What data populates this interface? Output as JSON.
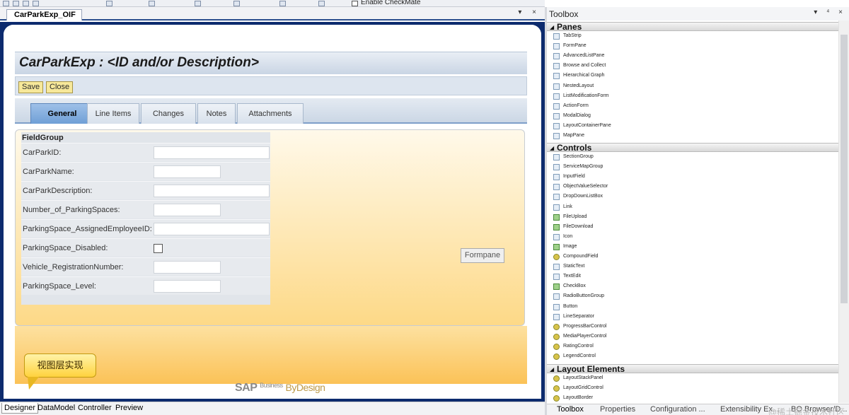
{
  "toolbar": {
    "enable_label": "Enable CheckMate"
  },
  "doc_tab": {
    "title": "CarParkExp_OIF",
    "controls": "▾ ×"
  },
  "page": {
    "title": "CarParkExp : <ID and/or Description>",
    "buttons": {
      "save": "Save",
      "close": "Close"
    },
    "tabs": [
      "General",
      "Line Items",
      "Changes",
      "Notes",
      "Attachments"
    ],
    "fieldgroup": {
      "title": "FieldGroup",
      "fields": [
        "CarParkID:",
        "CarParkName:",
        "CarParkDescription:",
        "Number_of_ParkingSpaces:",
        "ParkingSpace_AssignedEmployeeID:",
        "ParkingSpace_Disabled:",
        "Vehicle_RegistrationNumber:",
        "ParkingSpace_Level:"
      ]
    },
    "formpane_label": "Formpane",
    "callout": "视图层实现",
    "logo": {
      "sap": "SAP",
      "business": "Business",
      "bydesign": "ByDesign"
    }
  },
  "bottom_tabs": [
    "Designer",
    "DataModel",
    "Controller",
    "Preview"
  ],
  "toolbox": {
    "title": "Toolbox",
    "controls": "▾ ⁴ ×",
    "categories": [
      {
        "name": "Panes",
        "items": [
          "TabStrip",
          "FormPane",
          "AdvancedListPane",
          "Browse and Collect",
          "Hierarchical Graph",
          "NestedLayout",
          "ListModificationForm",
          "ActionForm",
          "ModalDialog",
          "LayoutContainerPane",
          "MapPane"
        ]
      },
      {
        "name": "Controls",
        "items": [
          "SectionGroup",
          "ServiceMapGroup",
          "InputField",
          "ObjectValueSelector",
          "DropDownListBox",
          "Link",
          "FileUpload",
          "FileDownload",
          "Icon",
          "Image",
          "CompoundField",
          "StaticText",
          "TextEdit",
          "CheckBox",
          "RadioButtonGroup",
          "Button",
          "LineSeparator",
          "ProgressBarControl",
          "MediaPlayerControl",
          "RatingControl",
          "LegendControl"
        ]
      },
      {
        "name": "Layout Elements",
        "items": [
          "LayoutStackPanel",
          "LayoutGridControl",
          "LayoutBorder"
        ]
      }
    ],
    "bottom_tabs": [
      "Toolbox",
      "Properties",
      "Configuration ...",
      "Extensibility Ex...",
      "BO Browser/D..."
    ],
    "watermark": "@稀土掘金技术社区"
  }
}
